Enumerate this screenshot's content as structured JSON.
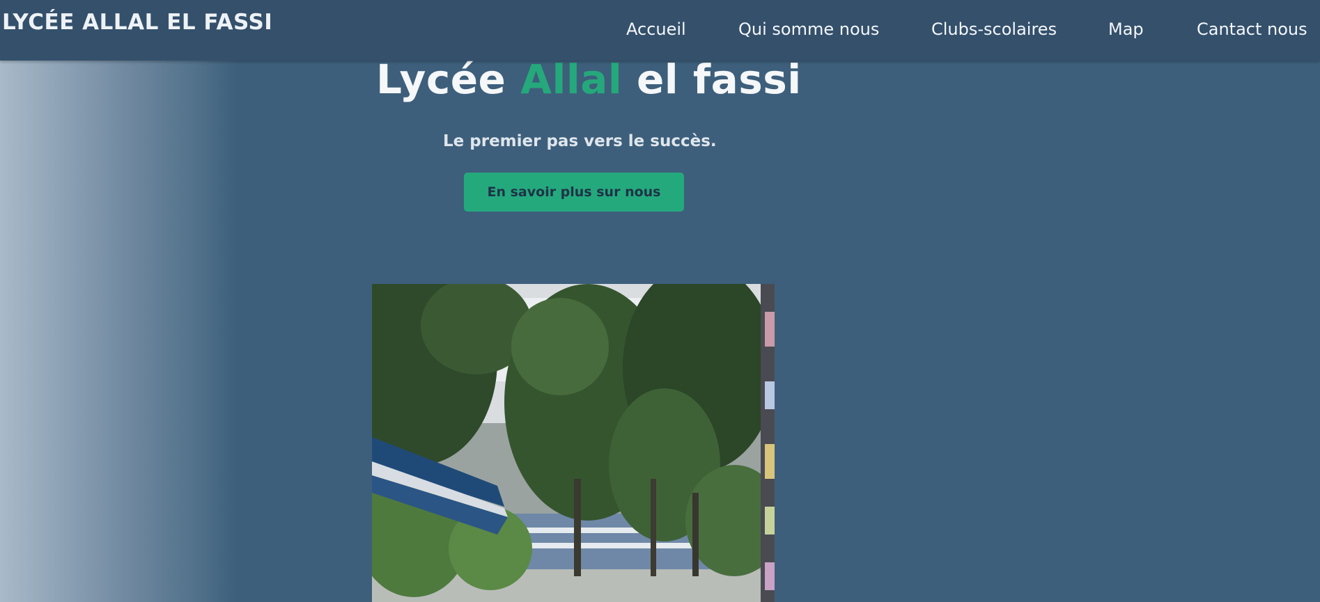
{
  "brand": "LYCÉE ALLAL EL FASSI",
  "nav": {
    "items": [
      {
        "label": "Accueil"
      },
      {
        "label": "Qui somme nous"
      },
      {
        "label": "Clubs-scolaires"
      },
      {
        "label": "Map"
      },
      {
        "label": "Cantact nous"
      }
    ]
  },
  "hero": {
    "title_part1": "Lycée ",
    "title_accent": "Allal",
    "title_part2": " el fassi",
    "tagline": "Le premier pas vers le succès.",
    "cta_label": "En savoir plus sur nous"
  },
  "colors": {
    "background": "#3d5f7b",
    "navbar": "#34506b",
    "accent": "#25a87b",
    "button": "#24a97d"
  }
}
